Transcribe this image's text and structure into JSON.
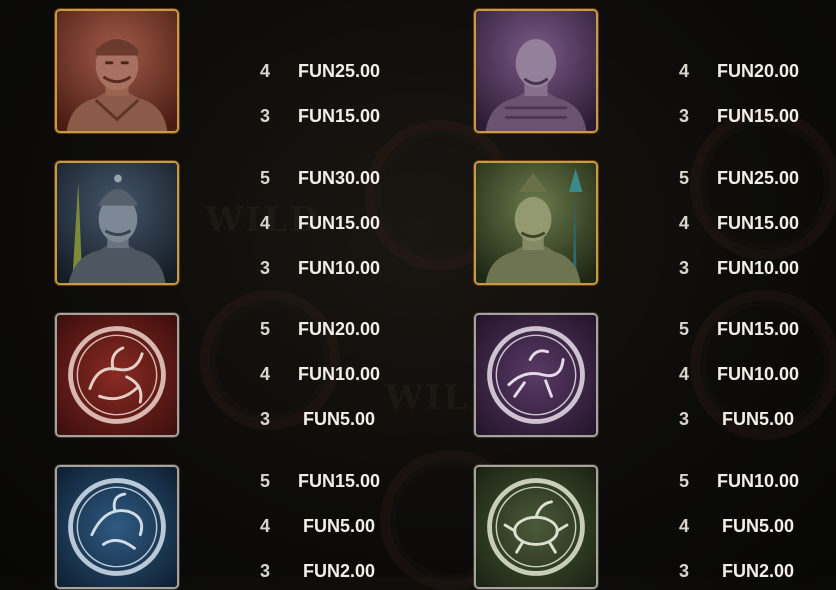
{
  "columns": [
    {
      "symbols": [
        {
          "name": "terracotta-general",
          "payouts": [
            {
              "count": "4",
              "amount": "FUN25.00"
            },
            {
              "count": "3",
              "amount": "FUN15.00"
            }
          ]
        },
        {
          "name": "terracotta-soldier-blue",
          "payouts": [
            {
              "count": "5",
              "amount": "FUN30.00"
            },
            {
              "count": "4",
              "amount": "FUN15.00"
            },
            {
              "count": "3",
              "amount": "FUN10.00"
            }
          ]
        },
        {
          "name": "red-dragon-medallion",
          "payouts": [
            {
              "count": "5",
              "amount": "FUN20.00"
            },
            {
              "count": "4",
              "amount": "FUN10.00"
            },
            {
              "count": "3",
              "amount": "FUN5.00"
            }
          ]
        },
        {
          "name": "blue-phoenix-medallion",
          "payouts": [
            {
              "count": "5",
              "amount": "FUN15.00"
            },
            {
              "count": "4",
              "amount": "FUN5.00"
            },
            {
              "count": "3",
              "amount": "FUN2.00"
            }
          ]
        }
      ]
    },
    {
      "symbols": [
        {
          "name": "terracotta-warrior-purple",
          "payouts": [
            {
              "count": "4",
              "amount": "FUN20.00"
            },
            {
              "count": "3",
              "amount": "FUN15.00"
            }
          ]
        },
        {
          "name": "terracotta-spearman-green",
          "payouts": [
            {
              "count": "5",
              "amount": "FUN25.00"
            },
            {
              "count": "4",
              "amount": "FUN15.00"
            },
            {
              "count": "3",
              "amount": "FUN10.00"
            }
          ]
        },
        {
          "name": "purple-tiger-medallion",
          "payouts": [
            {
              "count": "5",
              "amount": "FUN15.00"
            },
            {
              "count": "4",
              "amount": "FUN10.00"
            },
            {
              "count": "3",
              "amount": "FUN5.00"
            }
          ]
        },
        {
          "name": "green-tortoise-medallion",
          "payouts": [
            {
              "count": "5",
              "amount": "FUN10.00"
            },
            {
              "count": "4",
              "amount": "FUN5.00"
            },
            {
              "count": "3",
              "amount": "FUN2.00"
            }
          ]
        }
      ]
    }
  ],
  "background_words": [
    "WILD",
    "WILD"
  ],
  "colors": {
    "gold_frame": "#c99a43",
    "silver_frame": "#a7a29a",
    "red_tile": "#6a1d1a",
    "purple_tile": "#3e2545",
    "blue_tile": "#1e3a5c",
    "green_tile": "#2f3f26",
    "text": "#f2efe8"
  }
}
